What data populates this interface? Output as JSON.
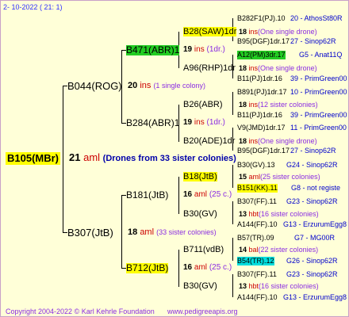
{
  "date": "2- 10-2022 ( 21: 1)",
  "root": {
    "name": "B105(MBr)",
    "num": "21",
    "tag": "aml",
    "note": "(Drones from 33 sister colonies)"
  },
  "g2": [
    {
      "name": "B044(ROG)",
      "num": "20",
      "tag": "ins",
      "note": "(1 single colony)"
    },
    {
      "name": "B307(JtB)",
      "num": "18",
      "tag": "aml",
      "note": "(33 sister colonies)"
    }
  ],
  "g3": [
    {
      "name": "B471(ABR)1",
      "num": "19",
      "tag": "ins",
      "note": "(1dr.)"
    },
    {
      "name": "B284(ABR)1",
      "num": "19",
      "tag": "ins",
      "note": "(1dr.)"
    },
    {
      "name": "B181(JtB)",
      "num": "16",
      "tag": "aml",
      "note": "(25 c.)"
    },
    {
      "name": "B712(JtB)",
      "num": "16",
      "tag": "aml",
      "note": "(25 c.)"
    }
  ],
  "g4": [
    {
      "name": "B28(SAW)1dr",
      "num": "18",
      "tag": "ins",
      "note": "(One single drone)"
    },
    {
      "name": "A96(RHP)1dr",
      "num": "18",
      "tag": "ins",
      "note": "(One single drone)"
    },
    {
      "name": "B26(ABR)",
      "num": "18",
      "tag": "ins",
      "note": "(12 sister colonies)"
    },
    {
      "name": "B20(ADE)1dr",
      "num": "18",
      "tag": "ins",
      "note": "(One single drone)"
    },
    {
      "name": "B18(JtB)",
      "num": "15",
      "tag": "aml",
      "note": "(25 sister colonies)"
    },
    {
      "name": "B30(GV)",
      "num": "13",
      "tag": "hbt",
      "note": "(16 sister colonies)"
    },
    {
      "name": "B711(vdB)",
      "num": "14",
      "tag": "bal",
      "note": "(22 sister colonies)"
    },
    {
      "name": "B30(GV)",
      "num": "13",
      "tag": "hbt",
      "note": "(16 sister colonies)"
    }
  ],
  "g5": [
    {
      "name": "B282F1(PJ).10",
      "side": "20 - AthosSt80R"
    },
    {
      "name": "B95(DGF)1dr.17",
      "side": "27 - Sinop62R"
    },
    {
      "name": "A12(PM)3dr.17",
      "side": "G5 - Anat11Q"
    },
    {
      "name": "B11(PJ)1dr.16",
      "side": "39 - PrimGreen00"
    },
    {
      "name": "B891(PJ)1dr.17",
      "side": "10 - PrimGreen00"
    },
    {
      "name": "B11(PJ)1dr.16",
      "side": "39 - PrimGreen00"
    },
    {
      "name": "V9(JMD)1dr.17",
      "side": "11 - PrimGreen00"
    },
    {
      "name": "B95(DGF)1dr.17",
      "side": "27 - Sinop62R"
    },
    {
      "name": "B30(GV).13",
      "side": "G24 - Sinop62R"
    },
    {
      "name": "B151(KK).11",
      "side": "G8 - not registe"
    },
    {
      "name": "B307(FF).11",
      "side": "G23 - Sinop62R"
    },
    {
      "name": "A144(FF).10",
      "side": "G13 - ErzurumEgg8"
    },
    {
      "name": "B57(TR).09",
      "side": "G7 - MG00R"
    },
    {
      "name": "B54(TR).12",
      "side": "G26 - Sinop62R"
    },
    {
      "name": "B307(FF).11",
      "side": "G23 - Sinop62R"
    },
    {
      "name": "A144(FF).10",
      "side": "G13 - ErzurumEgg8"
    }
  ],
  "footer": {
    "copyright": "Copyright 2004-2022 © Karl Kehrle Foundation",
    "url": "www.pedigreeapis.org"
  }
}
